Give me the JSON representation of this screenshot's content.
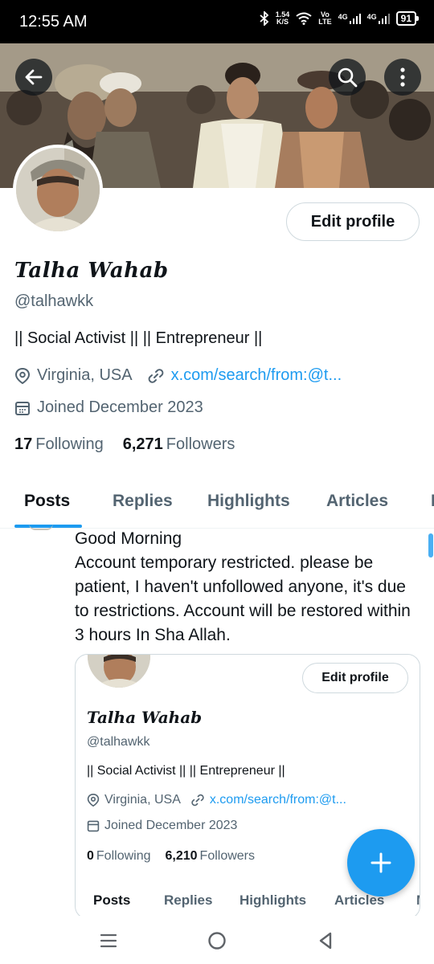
{
  "status_bar": {
    "time": "12:55 AM",
    "net_speed_value": "1.54",
    "net_speed_unit": "K/S",
    "volte_top": "Vo",
    "volte_bottom": "LTE",
    "net1": "4G",
    "net2": "4G",
    "battery": "91"
  },
  "profile": {
    "edit_label": "Edit profile",
    "display_name": "Talha Wahab",
    "handle": "@talhawkk",
    "bio": "|| Social Activist || || Entrepreneur ||",
    "location": "Virginia, USA",
    "website": "x.com/search/from:@t...",
    "joined": "Joined December 2023",
    "following_count": "17",
    "following_label": "Following",
    "followers_count": "6,271",
    "followers_label": "Followers"
  },
  "tabs": [
    "Posts",
    "Replies",
    "Highlights",
    "Articles",
    "M"
  ],
  "active_tab": "Posts",
  "post": {
    "line1": "Good Morning",
    "body": "Account temporary restricted. please be patient, I haven't unfollowed anyone, it's due to restrictions. Account will be restored within 3 hours In Sha Allah."
  },
  "embed": {
    "edit_label": "Edit profile",
    "display_name": "Talha Wahab",
    "handle": "@talhawkk",
    "bio": "|| Social Activist || || Entrepreneur ||",
    "location": "Virginia, USA",
    "website": "x.com/search/from:@t...",
    "joined": "Joined December 2023",
    "following_count": "0",
    "following_label": "Following",
    "followers_count": "6,210",
    "followers_label": "Followers",
    "tabs": [
      "Posts",
      "Replies",
      "Highlights",
      "Articles",
      "M"
    ]
  },
  "colors": {
    "accent": "#1d9bf0",
    "text_primary": "#0f1419",
    "text_secondary": "#536471",
    "border": "#cfd9de"
  },
  "icons": [
    "back-arrow-icon",
    "search-icon",
    "more-vertical-icon",
    "location-pin-icon",
    "link-icon",
    "calendar-icon",
    "plus-icon",
    "nav-recents-icon",
    "nav-home-icon",
    "nav-back-icon"
  ]
}
